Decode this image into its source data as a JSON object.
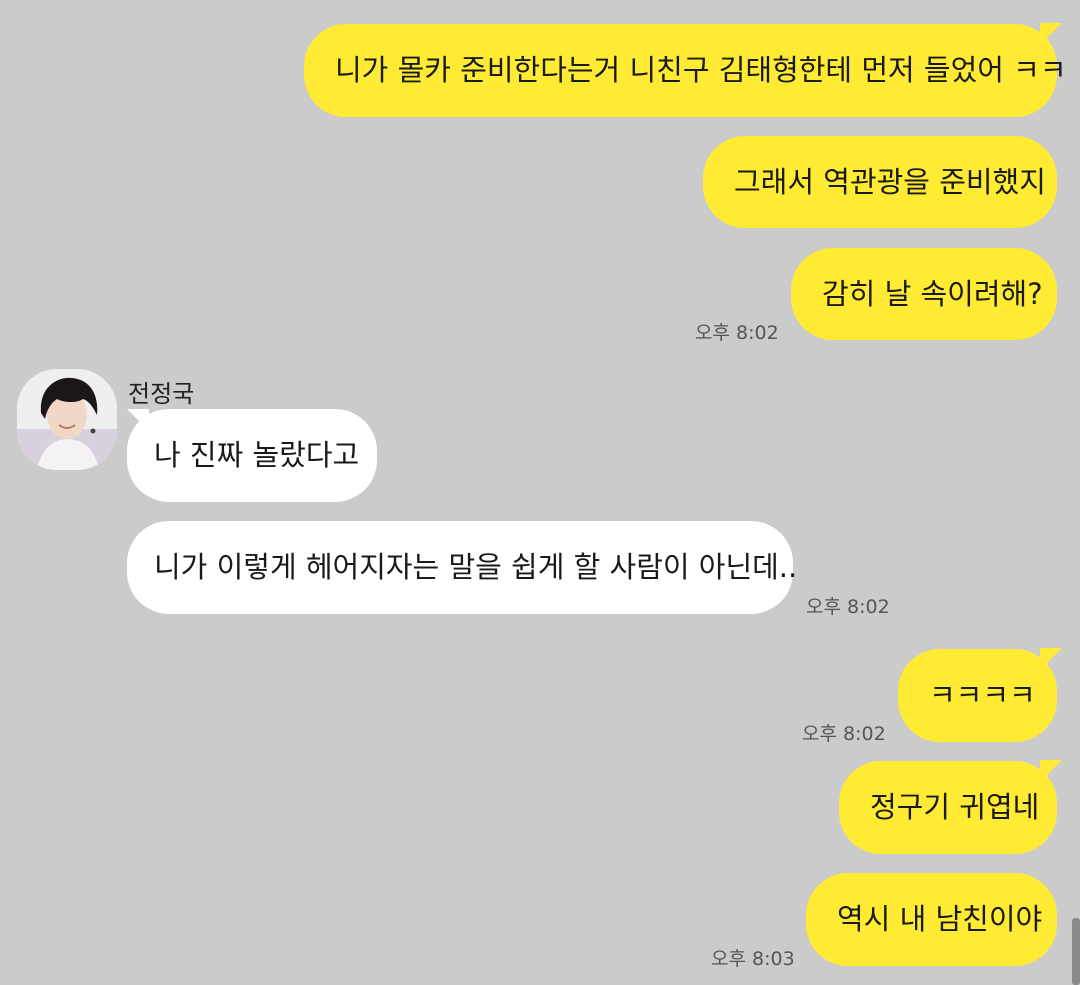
{
  "chat": {
    "contact_name": "전정국",
    "messages": [
      {
        "from": "me",
        "text": "니가 몰카 준비한다는거 니친구 김태형한테 먼저 들었어 ㅋㅋ"
      },
      {
        "from": "me",
        "text": "그래서 역관광을 준비했지"
      },
      {
        "from": "me",
        "text": "감히 날 속이려해?",
        "time": "오후 8:02"
      },
      {
        "from": "other",
        "text": "나 진짜 놀랐다고"
      },
      {
        "from": "other",
        "text": "니가 이렇게 헤어지자는 말을 쉽게 할 사람이 아닌데..",
        "time": "오후 8:02"
      },
      {
        "from": "me",
        "text": "ㅋㅋㅋㅋ",
        "time": "오후 8:02"
      },
      {
        "from": "me",
        "text": "정구기 귀엽네"
      },
      {
        "from": "me",
        "text": "역시 내 남친이야",
        "time": "오후 8:03"
      }
    ]
  },
  "colors": {
    "background": "#cbcbcb",
    "my_bubble": "#ffeb33",
    "their_bubble": "#ffffff"
  },
  "icons": {
    "avatar": "profile-photo"
  }
}
